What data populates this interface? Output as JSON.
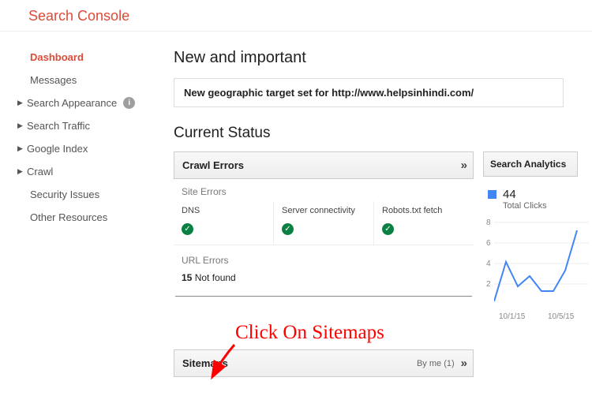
{
  "app": {
    "title": "Search Console"
  },
  "nav": {
    "dashboard": "Dashboard",
    "messages": "Messages",
    "search_appearance": "Search Appearance",
    "search_traffic": "Search Traffic",
    "google_index": "Google Index",
    "crawl": "Crawl",
    "security_issues": "Security Issues",
    "other_resources": "Other Resources"
  },
  "main": {
    "new_important": "New and important",
    "notice": "New geographic target set for http://www.helpsinhindi.com/",
    "current_status": "Current Status"
  },
  "crawl_errors": {
    "title": "Crawl Errors",
    "site_errors": "Site Errors",
    "dns": "DNS",
    "server": "Server connectivity",
    "robots": "Robots.txt fetch",
    "url_errors": "URL Errors",
    "not_found_count": "15",
    "not_found_label": " Not found"
  },
  "sitemaps": {
    "title": "Sitemaps",
    "by_me": "By me (1)"
  },
  "analytics": {
    "title": "Search Analytics",
    "value": "44",
    "label": "Total Clicks",
    "y8": "8",
    "y6": "6",
    "y4": "4",
    "y2": "2",
    "x1": "10/1/15",
    "x2": "10/5/15"
  },
  "annotation": {
    "text": "Click On Sitemaps"
  },
  "chart_data": {
    "type": "line",
    "title": "Search Analytics - Total Clicks",
    "xlabel": "",
    "ylabel": "",
    "ylim": [
      0,
      8
    ],
    "x": [
      "9/30/15",
      "10/1/15",
      "10/2/15",
      "10/3/15",
      "10/4/15",
      "10/5/15",
      "10/6/15",
      "10/7/15"
    ],
    "values": [
      0,
      4,
      1.5,
      2.5,
      1,
      1,
      3,
      7
    ]
  }
}
